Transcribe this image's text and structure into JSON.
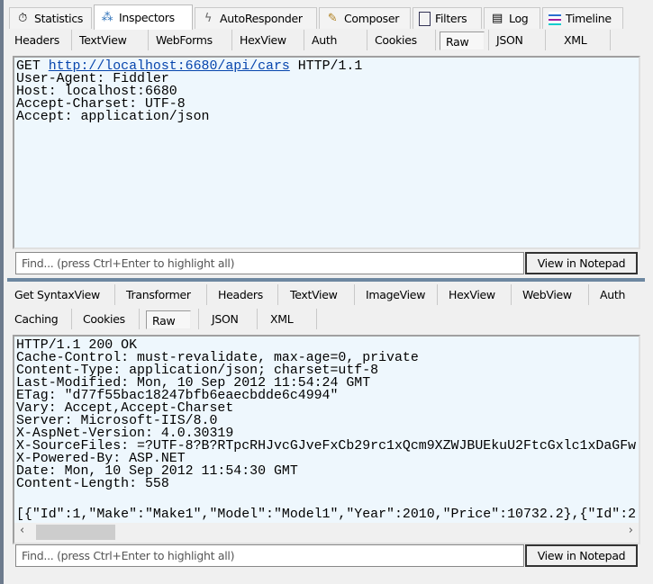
{
  "main_tabs": [
    {
      "label": "Statistics",
      "icon": "stopwatch-icon"
    },
    {
      "label": "Inspectors",
      "icon": "inspector-icon",
      "selected": true
    },
    {
      "label": "AutoResponder",
      "icon": "lightning-icon"
    },
    {
      "label": "Composer",
      "icon": "compose-icon"
    },
    {
      "label": "Filters",
      "icon": "checkbox-icon"
    },
    {
      "label": "Log",
      "icon": "log-icon"
    },
    {
      "label": "Timeline",
      "icon": "timeline-icon"
    }
  ],
  "request": {
    "tabs": [
      "Headers",
      "TextView",
      "WebForms",
      "HexView",
      "Auth",
      "Cookies",
      "Raw",
      "JSON",
      "XML"
    ],
    "selected_tab": "Raw",
    "method": "GET",
    "url": "http://localhost:6680/api/cars",
    "protocol": "HTTP/1.1",
    "lines": [
      "User-Agent: Fiddler",
      "Host: localhost:6680",
      "Accept-Charset: UTF-8",
      "Accept: application/json"
    ],
    "find_placeholder": "Find... (press Ctrl+Enter to highlight all)",
    "notepad_label": "View in Notepad"
  },
  "response": {
    "tabs_row1": [
      "Get SyntaxView",
      "Transformer",
      "Headers",
      "TextView",
      "ImageView",
      "HexView",
      "WebView",
      "Auth"
    ],
    "tabs_row2": [
      "Caching",
      "Cookies",
      "Raw",
      "JSON",
      "XML"
    ],
    "selected_tab": "Raw",
    "lines": [
      "HTTP/1.1 200 OK",
      "Cache-Control: must-revalidate, max-age=0, private",
      "Content-Type: application/json; charset=utf-8",
      "Last-Modified: Mon, 10 Sep 2012 11:54:24 GMT",
      "ETag: \"d77f55bac18247bfb6eaecbdde6c4994\"",
      "Vary: Accept,Accept-Charset",
      "Server: Microsoft-IIS/8.0",
      "X-AspNet-Version: 4.0.30319",
      "X-SourceFiles: =?UTF-8?B?RTpcRHJvcGJveFxCb29rc1xQcm9XZWJBUEkuU2FtcGxlc1xDaGFw",
      "X-Powered-By: ASP.NET",
      "Date: Mon, 10 Sep 2012 11:54:30 GMT",
      "Content-Length: 558",
      "",
      "[{\"Id\":1,\"Make\":\"Make1\",\"Model\":\"Model1\",\"Year\":2010,\"Price\":10732.2},{\"Id\":2"
    ],
    "find_placeholder": "Find... (press Ctrl+Enter to highlight all)",
    "notepad_label": "View in Notepad"
  }
}
